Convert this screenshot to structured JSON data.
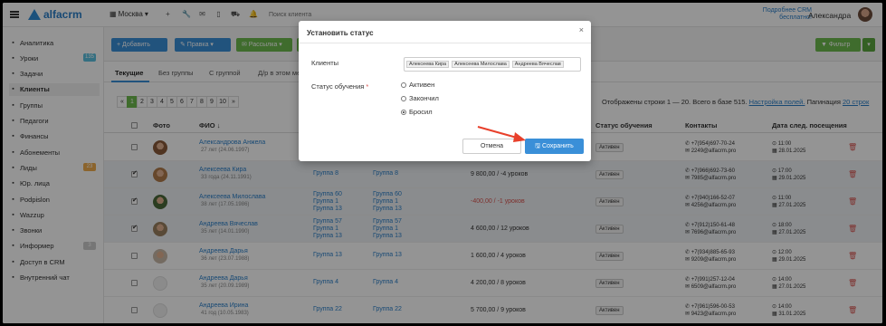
{
  "topbar": {
    "logo": "alfacrm",
    "branch": "Москва",
    "search_placeholder": "Поиск клиента",
    "bonus": "Подробнее CRM бесплатно!",
    "username": "Александра"
  },
  "sidebar": {
    "items": [
      {
        "label": "Аналитика",
        "icon": "chart-icon"
      },
      {
        "label": "Уроки",
        "icon": "calendar-icon",
        "badge": "135",
        "badge_color": "#5bc0de"
      },
      {
        "label": "Задачи",
        "icon": "tasks-icon"
      },
      {
        "label": "Клиенты",
        "icon": "user-icon",
        "active": true
      },
      {
        "label": "Группы",
        "icon": "users-icon"
      },
      {
        "label": "Педагоги",
        "icon": "graduation-icon"
      },
      {
        "label": "Финансы",
        "icon": "money-icon"
      },
      {
        "label": "Абонементы",
        "icon": "subscription-icon"
      },
      {
        "label": "Лиды",
        "icon": "leads-icon",
        "badge": "23",
        "badge_color": "#f0ad4e"
      },
      {
        "label": "Юр. лица",
        "icon": "building-icon"
      },
      {
        "label": "Podpislon",
        "icon": "doc-icon"
      },
      {
        "label": "Wazzup",
        "icon": "whatsapp-icon"
      },
      {
        "label": "Звонки",
        "icon": "phone-icon"
      },
      {
        "label": "Информер",
        "icon": "informer-icon",
        "badge": "3",
        "badge_color": "#cccccc"
      },
      {
        "label": "Доступ в CRM",
        "icon": "lock-icon"
      },
      {
        "label": "Внутренний чат",
        "icon": "chat-icon"
      }
    ]
  },
  "actions": {
    "add": "+ Добавить",
    "edit": "✎ Правка ▾",
    "mail": "✉ Рассылка ▾",
    "more": "≡ ▾",
    "filter": "▼ Фильтр",
    "filter_caret": "▾"
  },
  "tabs": [
    "Текущие",
    "Без группы",
    "С группой",
    "Д/р в этом ме..."
  ],
  "pagination": [
    "«",
    "1",
    "2",
    "3",
    "4",
    "5",
    "6",
    "7",
    "8",
    "9",
    "10",
    "»"
  ],
  "rows_info": {
    "text": "Отображены строки 1 — 20. Всего в базе 515.",
    "settings_link": "Настройка полей.",
    "pagination_label": "Пагинация",
    "pagination_value": "20 строк"
  },
  "table": {
    "headers": {
      "photo": "Фото",
      "fio": "ФИО ↓",
      "status": "Статус обучения",
      "contacts": "Контакты",
      "next_visit": "Дата след. посещения"
    },
    "rows": [
      {
        "name": "Александрова Анжела",
        "age": "27 лет (24.06.1997)",
        "groups": [],
        "groups2": [],
        "balance": "",
        "status": "Активен",
        "phone": "+7(954)697-70-24",
        "email": "2249@alfacrm.pro",
        "time": "11:00",
        "date": "28.01.2025",
        "checked": false
      },
      {
        "name": "Алексеева Кира",
        "age": "33 года (24.11.1991)",
        "groups": [
          "Группа 8"
        ],
        "groups2": [
          "Группа 8"
        ],
        "balance": "9 800,00 / -4 уроков",
        "status": "Активен",
        "phone": "+7(966)692-73-60",
        "email": "7985@alfacrm.pro",
        "time": "17:00",
        "date": "29.01.2025",
        "checked": true
      },
      {
        "name": "Алексеева Милослава",
        "age": "38 лет (17.05.1986)",
        "groups": [
          "Группа 60",
          "Группа 1",
          "Группа 13"
        ],
        "groups2": [
          "Группа 60",
          "Группа 1",
          "Группа 13"
        ],
        "balance": "-400,00 / -1 уроков",
        "negative": true,
        "status": "Активен",
        "phone": "+7(940)166-52-07",
        "email": "4256@alfacrm.pro",
        "time": "11:00",
        "date": "27.01.2025",
        "checked": true
      },
      {
        "name": "Андреева Вячеслав",
        "age": "35 лет (14.01.1990)",
        "groups": [
          "Группа 57",
          "Группа 1",
          "Группа 13"
        ],
        "groups2": [
          "Группа 57",
          "Группа 1",
          "Группа 13"
        ],
        "balance": "4 600,00 / 12 уроков",
        "status": "Активен",
        "phone": "+7(912)150-61-48",
        "email": "7696@alfacrm.pro",
        "time": "18:00",
        "date": "27.01.2025",
        "checked": true
      },
      {
        "name": "Андреева Дарья",
        "age": "36 лет (23.07.1988)",
        "groups": [
          "Группа 13"
        ],
        "groups2": [
          "Группа 13"
        ],
        "balance": "1 600,00 / 4 уроков",
        "status": "Активен",
        "phone": "+7(934)885-65-93",
        "email": "9209@alfacrm.pro",
        "time": "12:00",
        "date": "29.01.2025",
        "checked": false
      },
      {
        "name": "Андреева Дарья",
        "age": "35 лет (20.09.1989)",
        "groups": [
          "Группа 4"
        ],
        "groups2": [
          "Группа 4"
        ],
        "balance": "4 200,00 / 8 уроков",
        "status": "Активен",
        "phone": "+7(991)257-12-04",
        "email": "6509@alfacrm.pro",
        "time": "14:00",
        "date": "27.01.2025",
        "checked": false
      },
      {
        "name": "Андреева Ирина",
        "age": "41 год (10.05.1983)",
        "groups": [
          "Группа 22"
        ],
        "groups2": [
          "Группа 22"
        ],
        "balance": "5 700,00 / 9 уроков",
        "status": "Активен",
        "phone": "+7(961)596-00-53",
        "email": "9423@alfacrm.pro",
        "time": "14:00",
        "date": "31.01.2025",
        "checked": false
      }
    ]
  },
  "modal": {
    "title": "Установить статус",
    "close": "×",
    "clients_label": "Клиенты",
    "clients": [
      "Алексеева Кира",
      "Алексеева Милослава",
      "Андреева Вячеслав"
    ],
    "status_label": "Статус обучения",
    "required": "*",
    "options": [
      {
        "label": "Активен",
        "checked": false
      },
      {
        "label": "Закончил",
        "checked": false
      },
      {
        "label": "Бросил",
        "checked": true
      }
    ],
    "cancel": "Отмена",
    "save": "🖫 Сохранить"
  },
  "colors": {
    "accent_blue": "#3a8fd8",
    "accent_green": "#6dbb4f",
    "danger": "#d9534f",
    "arrow": "#e8402b"
  }
}
